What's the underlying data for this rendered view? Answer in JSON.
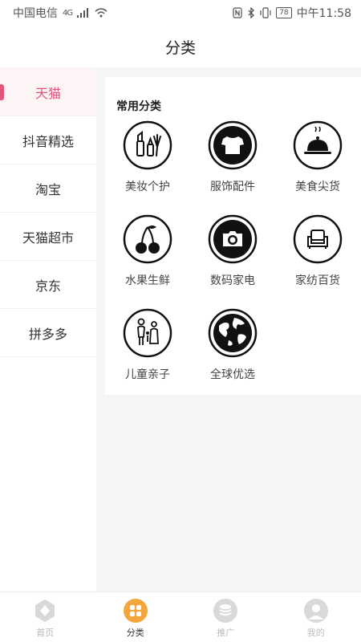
{
  "status_bar": {
    "carrier": "中国电信",
    "network": "4G",
    "battery": "78",
    "time": "中午11:58"
  },
  "header": {
    "title": "分类"
  },
  "sidebar": {
    "items": [
      {
        "label": "天猫",
        "active": true
      },
      {
        "label": "抖音精选"
      },
      {
        "label": "淘宝"
      },
      {
        "label": "天猫超市"
      },
      {
        "label": "京东"
      },
      {
        "label": "拼多多"
      }
    ],
    "accent_color": "#e2557a"
  },
  "main": {
    "section_title": "常用分类",
    "categories": [
      {
        "label": "美妆个护",
        "icon": "makeup-icon"
      },
      {
        "label": "服饰配件",
        "icon": "tshirt-icon"
      },
      {
        "label": "美食尖货",
        "icon": "food-cloche-icon"
      },
      {
        "label": "水果生鲜",
        "icon": "cherry-icon"
      },
      {
        "label": "数码家电",
        "icon": "camera-icon"
      },
      {
        "label": "家纺百货",
        "icon": "sofa-icon"
      },
      {
        "label": "儿童亲子",
        "icon": "family-icon"
      },
      {
        "label": "全球优选",
        "icon": "globe-icon"
      }
    ]
  },
  "tabbar": {
    "tabs": [
      {
        "label": "首页",
        "icon": "home-icon"
      },
      {
        "label": "分类",
        "icon": "category-icon",
        "active": true
      },
      {
        "label": "推广",
        "icon": "coins-icon"
      },
      {
        "label": "我的",
        "icon": "profile-icon"
      }
    ],
    "active_color": "#f3a63b"
  }
}
